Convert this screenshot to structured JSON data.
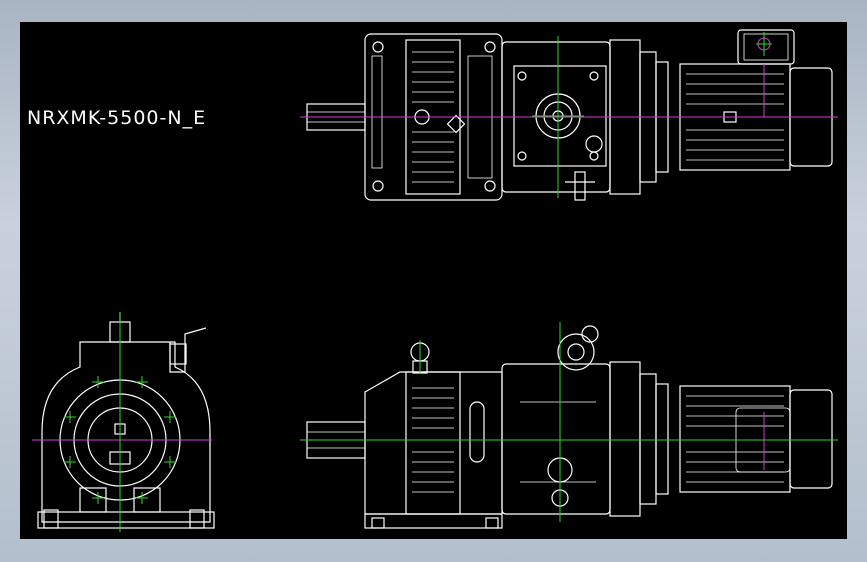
{
  "drawing": {
    "model_label": "NRXMK-5500-N_E"
  },
  "colors": {
    "frame_bg": "#c3ccd8",
    "canvas_bg": "#000000",
    "linework": "#ffffff",
    "centerline_green": "#2fd42f",
    "centerline_magenta": "#d23fd2"
  },
  "views": [
    "top-view",
    "front-end-view",
    "side-elevation-view"
  ]
}
